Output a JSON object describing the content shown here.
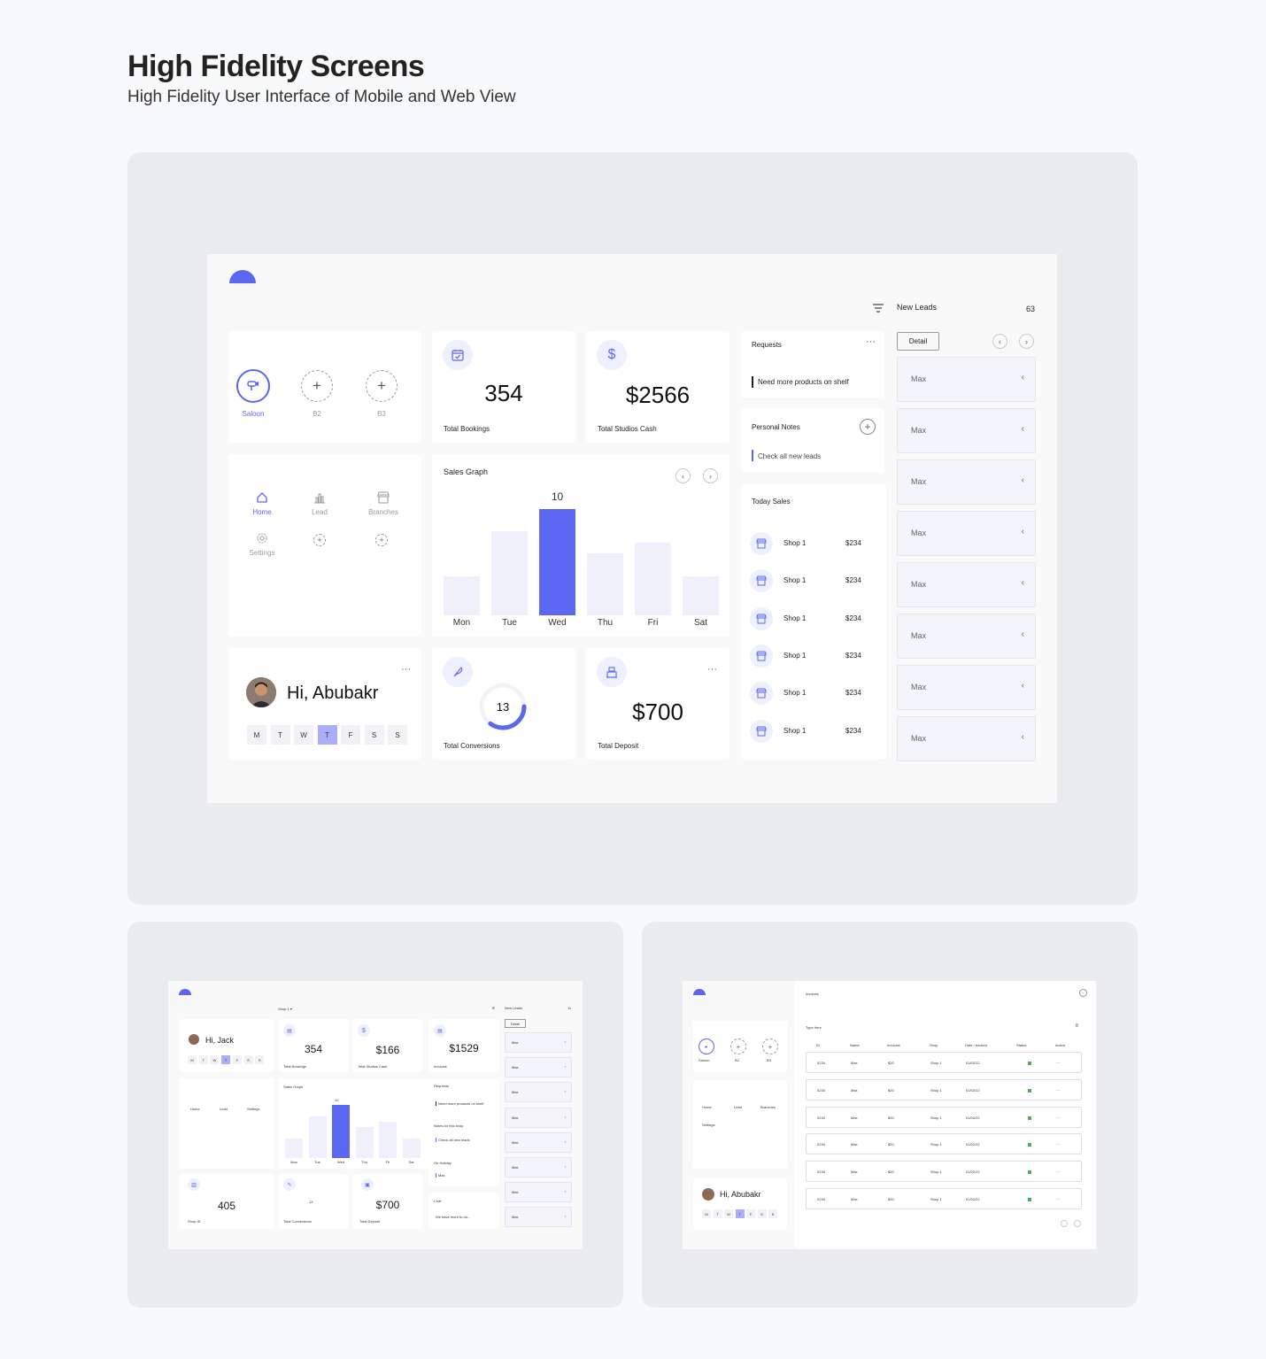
{
  "header": {
    "title": "High Fidelity Screens",
    "subtitle": "High Fidelity User Interface of Mobile and Web View"
  },
  "main": {
    "categories": [
      {
        "label": "Saloon",
        "icon": "hair-dryer-icon",
        "active": true
      },
      {
        "label": "B2",
        "icon": "plus-icon",
        "active": false
      },
      {
        "label": "B3",
        "icon": "plus-icon",
        "active": false
      }
    ],
    "stats": {
      "bookings": {
        "value": "354",
        "label": "Total Bookings",
        "icon": "calendar-icon"
      },
      "cash": {
        "value": "$2566",
        "label": "Total Studios Cash",
        "icon": "dollar-icon"
      },
      "conversions": {
        "value": "13",
        "label": "Total Conversions",
        "icon": "quill-icon",
        "progress": 0.35
      },
      "deposit": {
        "value": "$700",
        "label": "Total Deposit",
        "icon": "cash-register-icon",
        "menu": "···"
      }
    },
    "nav": {
      "home": "Home",
      "lead": "Lead",
      "branches": "Branches",
      "settings": "Settings"
    },
    "greeting": {
      "text": "Hi, Abubakr",
      "menu": "···",
      "days": [
        "M",
        "T",
        "W",
        "T",
        "F",
        "S",
        "S"
      ],
      "active_day": 3
    },
    "requests": {
      "title": "Requests",
      "menu": "···",
      "item": "Need more products on shelf"
    },
    "notes": {
      "title": "Personal Notes",
      "item": "Check all new leads"
    },
    "today_sales": {
      "title": "Today Sales",
      "rows": [
        {
          "name": "Shop 1",
          "amount": "$234"
        },
        {
          "name": "Shop 1",
          "amount": "$234"
        },
        {
          "name": "Shop 1",
          "amount": "$234"
        },
        {
          "name": "Shop 1",
          "amount": "$234"
        },
        {
          "name": "Shop 1",
          "amount": "$234"
        },
        {
          "name": "Shop 1",
          "amount": "$234"
        }
      ]
    },
    "leads": {
      "title": "New Leads",
      "count": "63",
      "detail": "Detail",
      "items": [
        "Max",
        "Max",
        "Max",
        "Max",
        "Max",
        "Max",
        "Max",
        "Max"
      ]
    }
  },
  "chart_data": {
    "type": "bar",
    "title": "Sales Graph",
    "categories": [
      "Mon",
      "Tue",
      "Wed",
      "Thu",
      "Fri",
      "Sat"
    ],
    "values": [
      3.7,
      7.9,
      10,
      5.8,
      6.8,
      3.7
    ],
    "highlight": "Wed",
    "highlight_label": "10",
    "ylim": [
      0,
      10
    ]
  },
  "mini1": {
    "shop": "Shop 1",
    "greeting": "Hi, Jack",
    "days": [
      "M",
      "T",
      "W",
      "T",
      "F",
      "S",
      "S"
    ],
    "bookings": "354",
    "bookings_label": "Total Bookings",
    "cash": "$166",
    "cash_label": "Total Studios Cash",
    "invoices": "$1529",
    "invoices_label": "Invoices",
    "graph_title": "Sales Graph",
    "graph_peak": "10",
    "graph_days": [
      "Mon",
      "Tue",
      "Wed",
      "Thu",
      "Fri",
      "Sat"
    ],
    "shop_id_value": "405",
    "shop_id_label": "Shop ID",
    "conversions": "13",
    "conversions_label": "Total Conversions",
    "deposit": "$700",
    "deposit_label": "Total Deposit",
    "requests": "Requests",
    "requests_item": "Need more products on shelf",
    "notes": "Notes for this shop",
    "notes_item": "Check all new leads",
    "holiday": "On Holiday",
    "holiday_item": "Max",
    "chat": "Chat",
    "chat_item": "We have more to do...",
    "leads_title": "New Leads",
    "leads_count": "11",
    "detail": "Detail",
    "nav": [
      "Home",
      "Lead",
      "Settings"
    ],
    "leads": [
      "Max",
      "Max",
      "Max",
      "Max",
      "Max",
      "Max",
      "Max",
      "Max"
    ]
  },
  "mini2": {
    "title": "Invoices",
    "search_placeholder": "Type here",
    "columns": [
      "ID",
      "Name",
      "Invoices",
      "Shop",
      "Date / booked",
      "Status",
      "Action"
    ],
    "rows": [
      [
        "0234",
        "Max",
        "$20",
        "Shop 1",
        "01/02/22",
        "",
        "···"
      ],
      [
        "0234",
        "Max",
        "$20",
        "Shop 1",
        "01/02/22",
        "",
        "···"
      ],
      [
        "0234",
        "Max",
        "$20",
        "Shop 1",
        "01/02/22",
        "",
        "···"
      ],
      [
        "0234",
        "Max",
        "$20",
        "Shop 1",
        "01/02/22",
        "",
        "···"
      ],
      [
        "0234",
        "Max",
        "$20",
        "Shop 1",
        "01/02/22",
        "",
        "···"
      ],
      [
        "0234",
        "Max",
        "$20",
        "Shop 1",
        "01/02/22",
        "",
        "···"
      ]
    ],
    "categories": [
      "Saloon",
      "B2",
      "B3"
    ],
    "nav": [
      "Home",
      "Lead",
      "Branches",
      "Settings"
    ],
    "greeting": "Hi, Abubakr",
    "days": [
      "M",
      "T",
      "W",
      "T",
      "F",
      "S",
      "S"
    ]
  },
  "colors": {
    "accent": "#5b67f0",
    "accent_light": "#eef0fd",
    "bar": "#f0f0fc",
    "status": "#4caf50"
  }
}
